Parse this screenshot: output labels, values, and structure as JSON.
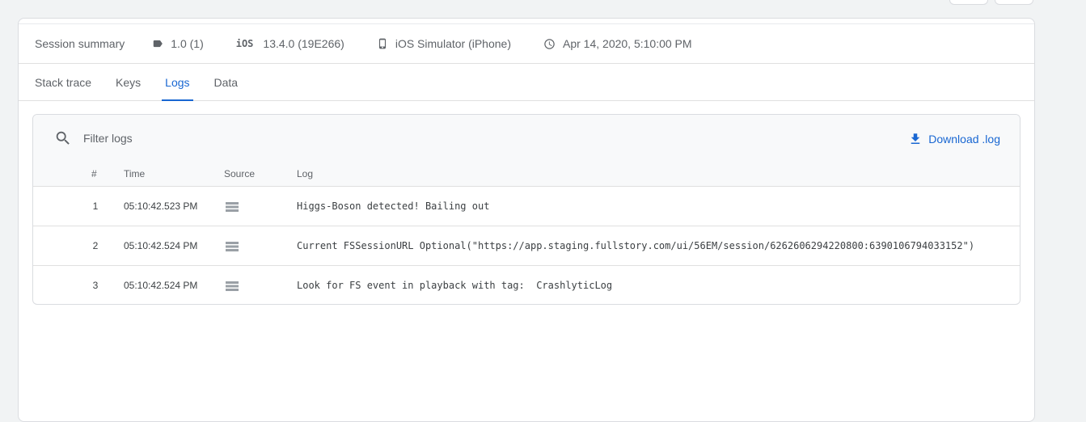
{
  "summary": {
    "title": "Session summary",
    "version": "1.0 (1)",
    "os_label": "iOS",
    "os_version": "13.4.0 (19E266)",
    "device": "iOS Simulator (iPhone)",
    "timestamp": "Apr 14, 2020, 5:10:00 PM"
  },
  "tabs": [
    {
      "label": "Stack trace",
      "active": false
    },
    {
      "label": "Keys",
      "active": false
    },
    {
      "label": "Logs",
      "active": true
    },
    {
      "label": "Data",
      "active": false
    }
  ],
  "logs": {
    "filter_placeholder": "Filter logs",
    "download_label": "Download .log",
    "columns": {
      "num": "#",
      "time": "Time",
      "source": "Source",
      "log": "Log"
    },
    "rows": [
      {
        "num": "1",
        "time": "05:10:42.523 PM",
        "source_icon": "list-icon",
        "log": "Higgs-Boson detected! Bailing out"
      },
      {
        "num": "2",
        "time": "05:10:42.524 PM",
        "source_icon": "list-icon",
        "log": "Current FSSessionURL Optional(\"https://app.staging.fullstory.com/ui/56EM/session/6262606294220800:6390106794033152\")"
      },
      {
        "num": "3",
        "time": "05:10:42.524 PM",
        "source_icon": "list-icon",
        "log": "Look for FS event in playback with tag:  CrashlyticLog"
      }
    ]
  }
}
